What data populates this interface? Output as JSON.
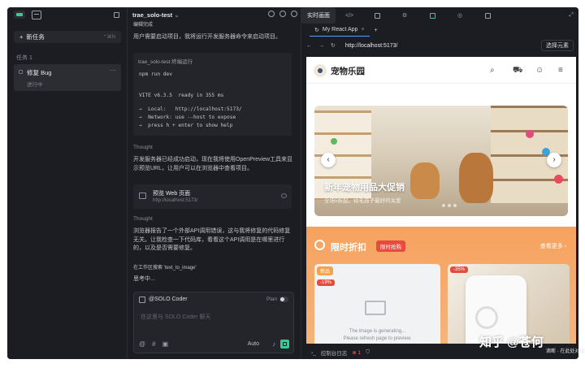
{
  "sidebar": {
    "new_task": "新任务",
    "new_task_kbd": "⌃⌘N",
    "tasks_header": "任务 1",
    "task_title": "修复 Bug",
    "task_status": "进行中"
  },
  "chat": {
    "title": "trae_solo-test",
    "top_partial": "编辑完成",
    "line1": "用户需要启动项目，我将运行开发服务器命令来启动项目。",
    "code_header": "trae_solo-test   终端运行",
    "cmd": "npm run dev",
    "out1": "VITE v6.3.5  ready in 355 ms",
    "out2": "→  Local:   http://localhost:5173/",
    "out3": "→  Network: use --host to expose",
    "out4": "→  press h + enter to show help",
    "thought1": "Thought",
    "para2": "开发服务器已经成功启动，现在我将使用OpenPreview工具来显示预览URL，让用户可以在浏览器中查看项目。",
    "preview_title": "预览 Web 页面",
    "preview_url": "http://localhost:5173/",
    "thought2": "Thought",
    "para3": "浏览器报告了一个外部API调用错误，这与我将修复的代码修复无关。让我检查一下代码库，看看这个API调用是在哪里进行的，以及是否需要修复。",
    "tool_line": "在工作区搜索 'text_to_image'",
    "thinking": "思考中...",
    "composer_who": "@SOLO Coder",
    "composer_plan": "Plan",
    "composer_ph": "在这里与 SOLO Coder 聊天",
    "composer_auto": "Auto"
  },
  "right": {
    "tab1": "实时画面",
    "tab_browser": "My React App",
    "url": "http://localhost:5173/",
    "select_btn": "选择元素",
    "brand": "宠物乐园",
    "hero_title": "新年宠物用品大促销",
    "hero_sub": "全场5折起，给毛孩子最好的关爱",
    "flash_title": "限时折扣",
    "flash_badge": "限时抢购",
    "flash_more": "查看更多 ›",
    "tag_new": "新品",
    "disc1": "-19%",
    "disc2": "-35%",
    "img_gen1": "The image is generating...",
    "img_gen2": "Please refresh page to preview.",
    "status_label": "控制台日志",
    "status_err": "⊗ 1",
    "watermark": "知乎 @苍何",
    "wm_small": "滴断 · 在此处对话"
  },
  "accent": "#32d08e"
}
